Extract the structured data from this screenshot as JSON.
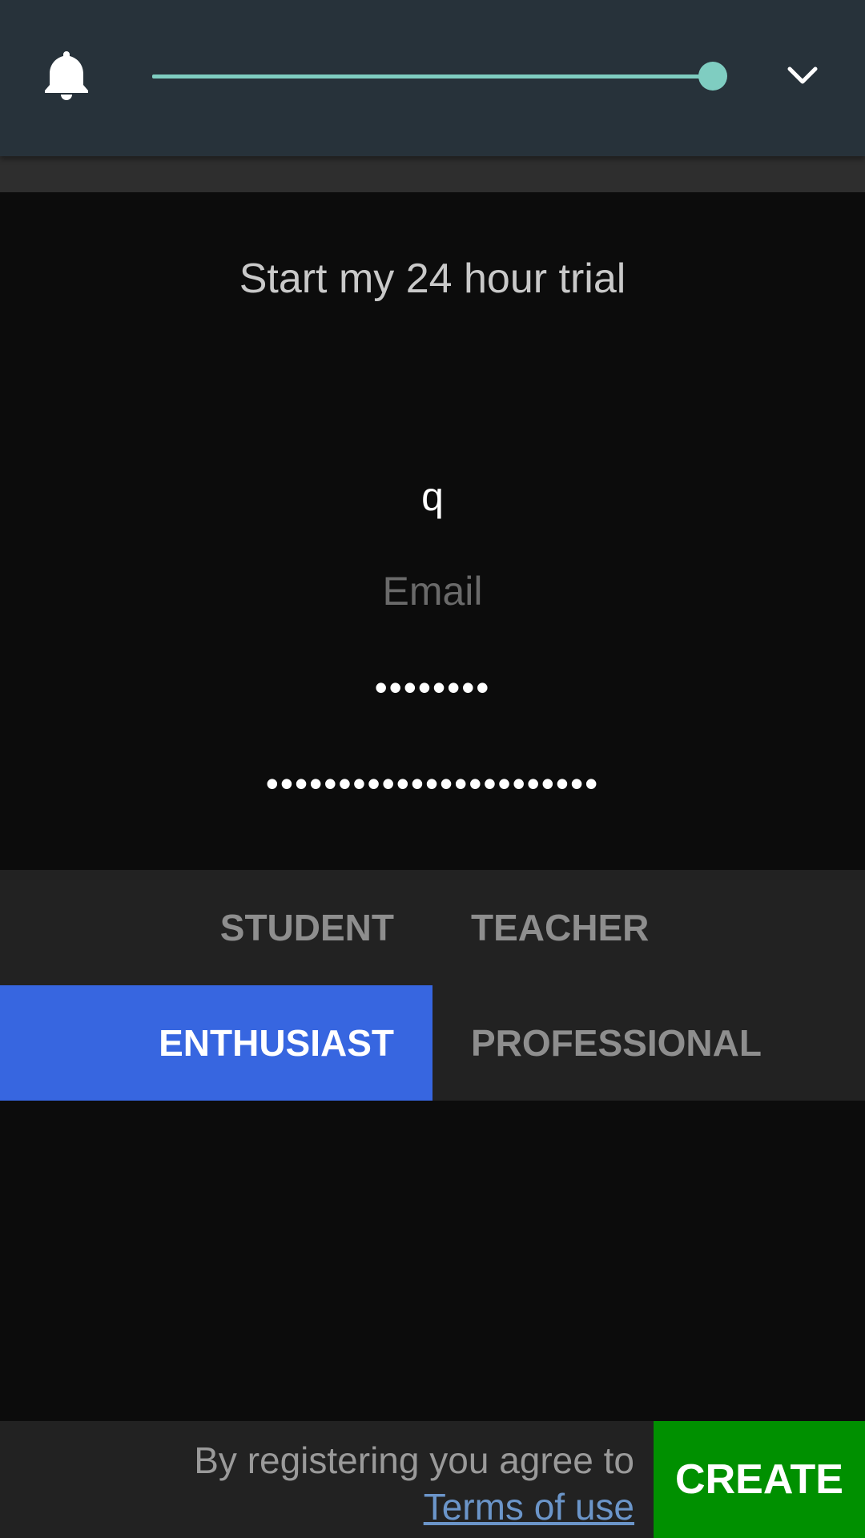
{
  "header": {
    "notification_icon": "bell-icon",
    "slider": {
      "value_percent": 100
    },
    "dropdown_icon": "chevron-down-icon"
  },
  "form": {
    "title": "Start my 24 hour trial",
    "name_value": "q",
    "email_placeholder": "Email",
    "password_value": "••••••••",
    "password_confirm_value": "•••••••••••••••••••••••"
  },
  "roles": {
    "options": [
      "STUDENT",
      "TEACHER",
      "ENTHUSIAST",
      "PROFESSIONAL"
    ],
    "selected": "ENTHUSIAST"
  },
  "footer": {
    "agree_text": "By registering you agree to",
    "terms_link": "Terms of use",
    "create_label": "CREATE"
  },
  "colors": {
    "topbar": "#27323a",
    "accent": "#7fcdc1",
    "selected_role": "#3766e0",
    "create_button": "#009000",
    "link": "#6b95c9"
  }
}
